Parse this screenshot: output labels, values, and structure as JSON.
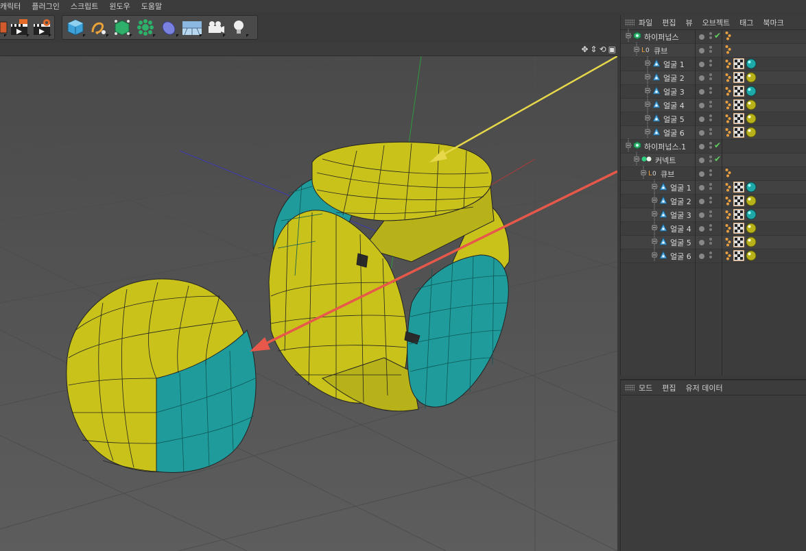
{
  "menubar": {
    "items": [
      "캐릭터",
      "플러그인",
      "스크립트",
      "윈도우",
      "도움말"
    ]
  },
  "object_manager": {
    "menu": [
      "파일",
      "편집",
      "뷰",
      "오브젝트",
      "태그",
      "북마크"
    ],
    "rows": [
      {
        "label": "하이퍼넙스",
        "icon": "hypernurbs-icon",
        "check": true,
        "tags": [
          "phong-tag"
        ]
      },
      {
        "label": "큐브",
        "icon": "polygon-object-icon",
        "check": false,
        "tags": [
          "phong-tag"
        ]
      },
      {
        "label": "얼굴 1",
        "icon": "selection-icon",
        "check": false,
        "tags": [
          "phong-tag",
          "checker-texture-tag",
          "cyan-material-tag"
        ]
      },
      {
        "label": "얼굴 2",
        "icon": "selection-icon",
        "check": false,
        "tags": [
          "phong-tag",
          "checker-texture-tag",
          "yellow-material-tag"
        ]
      },
      {
        "label": "얼굴 3",
        "icon": "selection-icon",
        "check": false,
        "tags": [
          "phong-tag",
          "checker-texture-tag",
          "cyan-material-tag"
        ]
      },
      {
        "label": "얼굴 4",
        "icon": "selection-icon",
        "check": false,
        "tags": [
          "phong-tag",
          "checker-texture-tag",
          "yellow-material-tag"
        ]
      },
      {
        "label": "얼굴 5",
        "icon": "selection-icon",
        "check": false,
        "tags": [
          "phong-tag",
          "checker-texture-tag",
          "yellow-material-tag"
        ]
      },
      {
        "label": "얼굴 6",
        "icon": "selection-icon",
        "check": false,
        "tags": [
          "phong-tag",
          "checker-texture-tag",
          "yellow-material-tag"
        ]
      },
      {
        "label": "하이퍼넙스.1",
        "icon": "hypernurbs-icon",
        "check": true,
        "tags": []
      },
      {
        "label": "커넥트",
        "icon": "connect-icon",
        "check": true,
        "tags": []
      },
      {
        "label": "큐브",
        "icon": "polygon-object-icon",
        "check": false,
        "tags": [
          "phong-tag"
        ]
      },
      {
        "label": "얼굴 1",
        "icon": "selection-icon",
        "check": false,
        "tags": [
          "phong-tag",
          "checker-texture-tag",
          "cyan-material-tag"
        ]
      },
      {
        "label": "얼굴 2",
        "icon": "selection-icon",
        "check": false,
        "tags": [
          "phong-tag",
          "checker-texture-tag",
          "yellow-material-tag"
        ]
      },
      {
        "label": "얼굴 3",
        "icon": "selection-icon",
        "check": false,
        "tags": [
          "phong-tag",
          "checker-texture-tag",
          "cyan-material-tag"
        ]
      },
      {
        "label": "얼굴 4",
        "icon": "selection-icon",
        "check": false,
        "tags": [
          "phong-tag",
          "checker-texture-tag",
          "yellow-material-tag"
        ]
      },
      {
        "label": "얼굴 5",
        "icon": "selection-icon",
        "check": false,
        "tags": [
          "phong-tag",
          "checker-texture-tag",
          "yellow-material-tag"
        ]
      },
      {
        "label": "얼굴 6",
        "icon": "selection-icon",
        "check": false,
        "tags": [
          "phong-tag",
          "checker-texture-tag",
          "yellow-material-tag"
        ]
      }
    ]
  },
  "attribute_manager": {
    "menu": [
      "모드",
      "편집",
      "유저 데이터"
    ]
  },
  "toolbar": {
    "icons": [
      "render-region-icon",
      "render-to-picture-viewer-icon",
      "render-settings-icon",
      "cube-icon",
      "spline-pen-icon",
      "nurbs-icon",
      "array-icon",
      "deformer-icon",
      "floor-icon",
      "camera-icon",
      "light-icon"
    ]
  },
  "colors": {
    "yellow": "#c8c21a",
    "cyan": "#1f9b9b",
    "yellow_arrow": "#e6d84a",
    "red_arrow": "#e8584a",
    "viewport_bg": "#575757"
  }
}
